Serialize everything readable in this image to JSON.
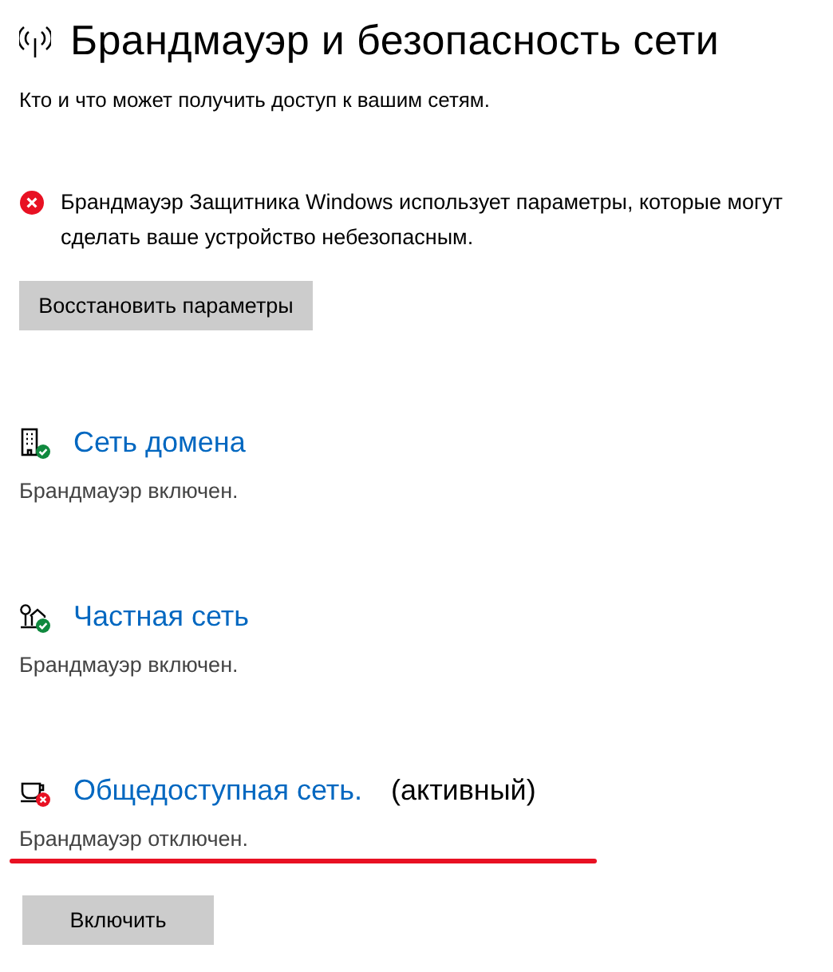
{
  "header": {
    "title": "Брандмауэр и безопасность сети",
    "subtitle": "Кто и что может получить доступ к вашим сетям."
  },
  "warning": {
    "text": "Брандмауэр Защитника Windows использует параметры, которые могут сделать ваше устройство небезопасным.",
    "button": "Восстановить параметры"
  },
  "networks": [
    {
      "kind": "domain",
      "name": "Сеть домена",
      "status": "Брандмауэр включен.",
      "enabled": true,
      "underlined": false
    },
    {
      "kind": "private",
      "name": "Частная сеть",
      "status": "Брандмауэр включен.",
      "enabled": true,
      "underlined": false
    },
    {
      "kind": "public",
      "name": "Общедоступная сеть.",
      "active_label": "(активный)",
      "status": "Брандмауэр отключен.",
      "enabled": false,
      "underlined": true,
      "button": "Включить"
    }
  ]
}
